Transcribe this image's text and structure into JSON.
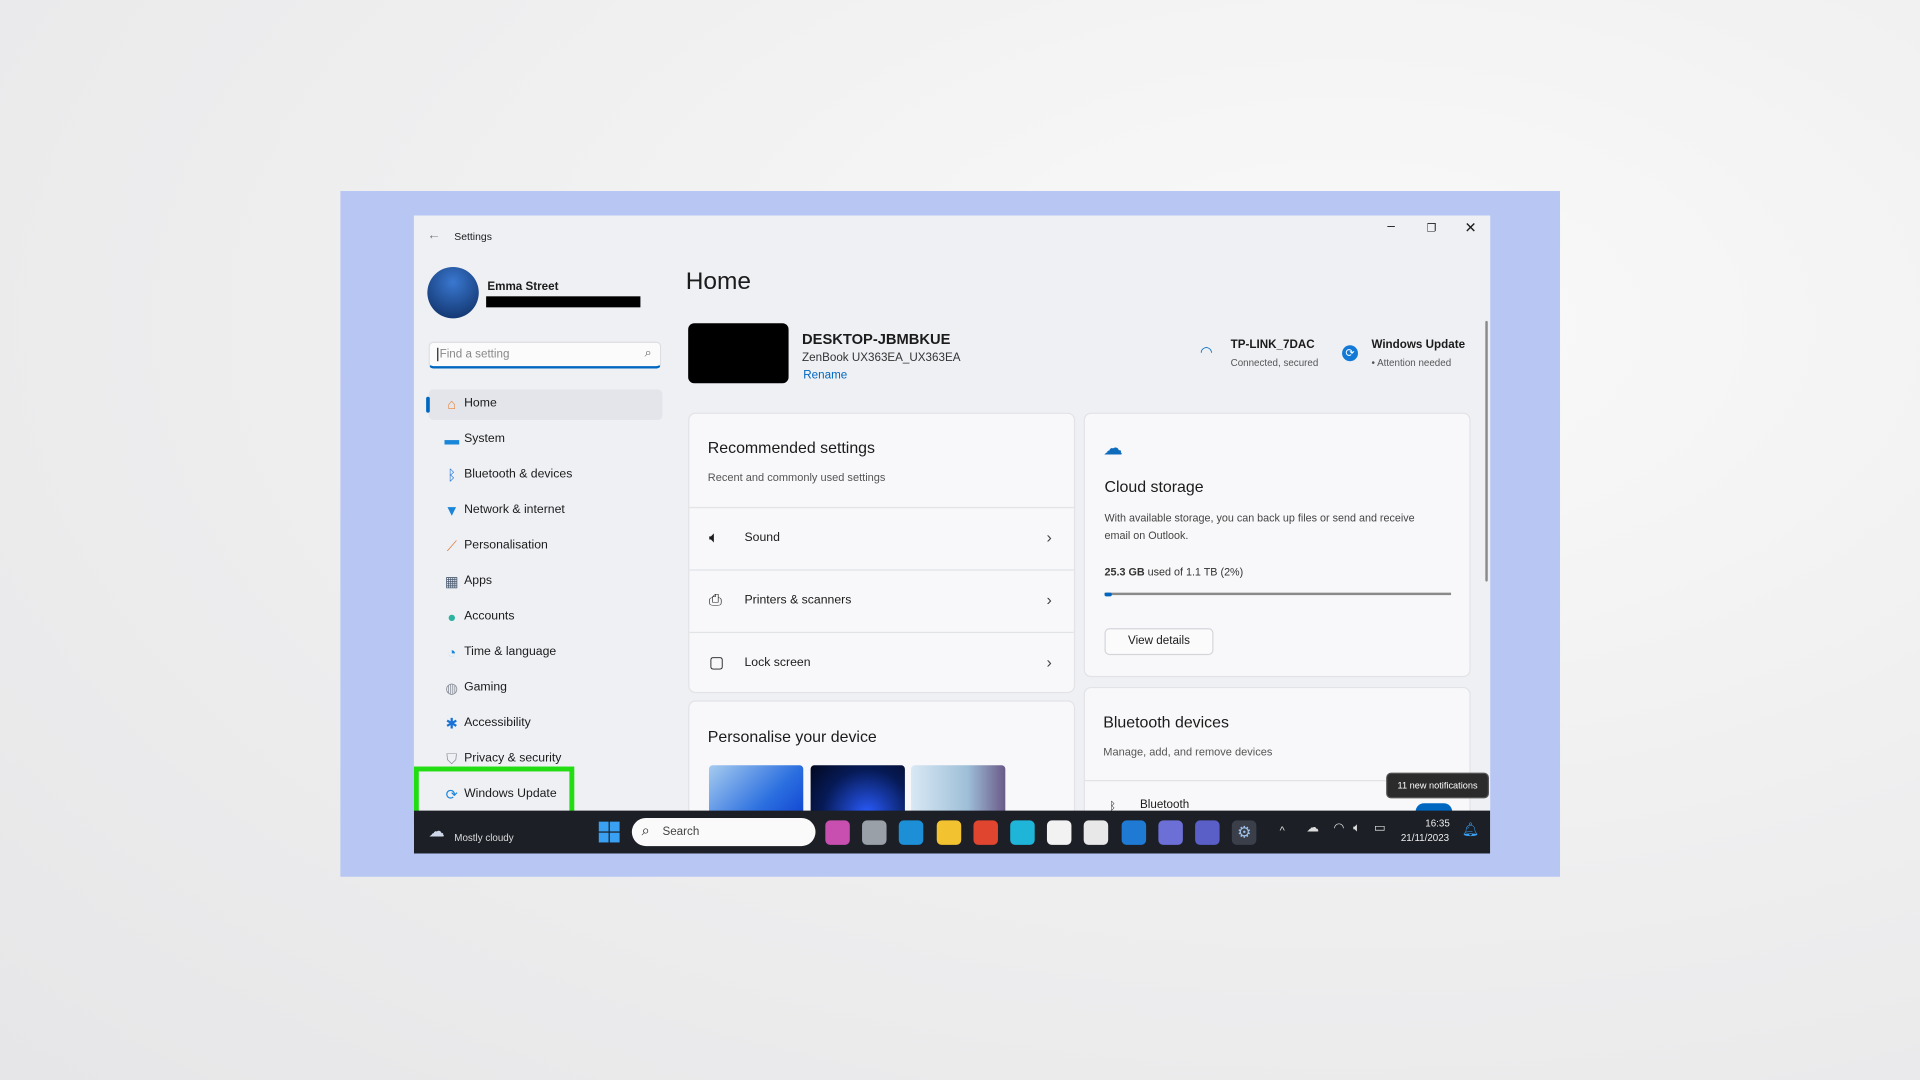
{
  "window": {
    "title": "Settings",
    "controls": [
      "minimize",
      "restore",
      "close"
    ]
  },
  "user": {
    "name": "Emma Street"
  },
  "search": {
    "placeholder": "Find a setting"
  },
  "nav": [
    {
      "label": "Home",
      "icon": "home-icon",
      "selected": true
    },
    {
      "label": "System",
      "icon": "system-icon"
    },
    {
      "label": "Bluetooth & devices",
      "icon": "bluetooth-icon"
    },
    {
      "label": "Network & internet",
      "icon": "wifi-icon"
    },
    {
      "label": "Personalisation",
      "icon": "brush-icon"
    },
    {
      "label": "Apps",
      "icon": "apps-icon"
    },
    {
      "label": "Accounts",
      "icon": "account-icon"
    },
    {
      "label": "Time & language",
      "icon": "clock-globe-icon"
    },
    {
      "label": "Gaming",
      "icon": "gamepad-icon"
    },
    {
      "label": "Accessibility",
      "icon": "accessibility-icon"
    },
    {
      "label": "Privacy & security",
      "icon": "shield-icon"
    },
    {
      "label": "Windows Update",
      "icon": "update-icon",
      "highlighted": true
    }
  ],
  "main": {
    "title": "Home",
    "device": {
      "name": "DESKTOP-JBMBKUE",
      "model": "ZenBook UX363EA_UX363EA",
      "rename": "Rename"
    },
    "network": {
      "name": "TP-LINK_7DAC",
      "status": "Connected, secured"
    },
    "update": {
      "name": "Windows Update",
      "status": "Attention needed"
    },
    "recommended": {
      "title": "Recommended settings",
      "subtitle": "Recent and commonly used settings",
      "items": [
        {
          "label": "Sound",
          "icon": "speaker-icon"
        },
        {
          "label": "Printers & scanners",
          "icon": "printer-icon"
        },
        {
          "label": "Lock screen",
          "icon": "lock-screen-icon"
        }
      ]
    },
    "personalise": {
      "title": "Personalise your device"
    },
    "cloud": {
      "title": "Cloud storage",
      "desc1": "With available storage, you can back up files or send and receive",
      "desc2": "email on Outlook.",
      "used": "25.3 GB",
      "of": "used of 1.1 TB (2%)",
      "percent": 2,
      "button": "View details"
    },
    "bluetooth": {
      "title": "Bluetooth devices",
      "subtitle": "Manage, add, and remove devices",
      "row": "Bluetooth",
      "toggle_on": true
    }
  },
  "tooltip": "11 new notifications",
  "taskbar": {
    "weather": "Mostly cloudy",
    "search": "Search",
    "time": "16:35",
    "date": "21/11/2023"
  },
  "colors": {
    "accent": "#0067c0",
    "highlight": "#22dd11",
    "frame": "#b7c6f3",
    "taskbar": "#1c1f26"
  }
}
